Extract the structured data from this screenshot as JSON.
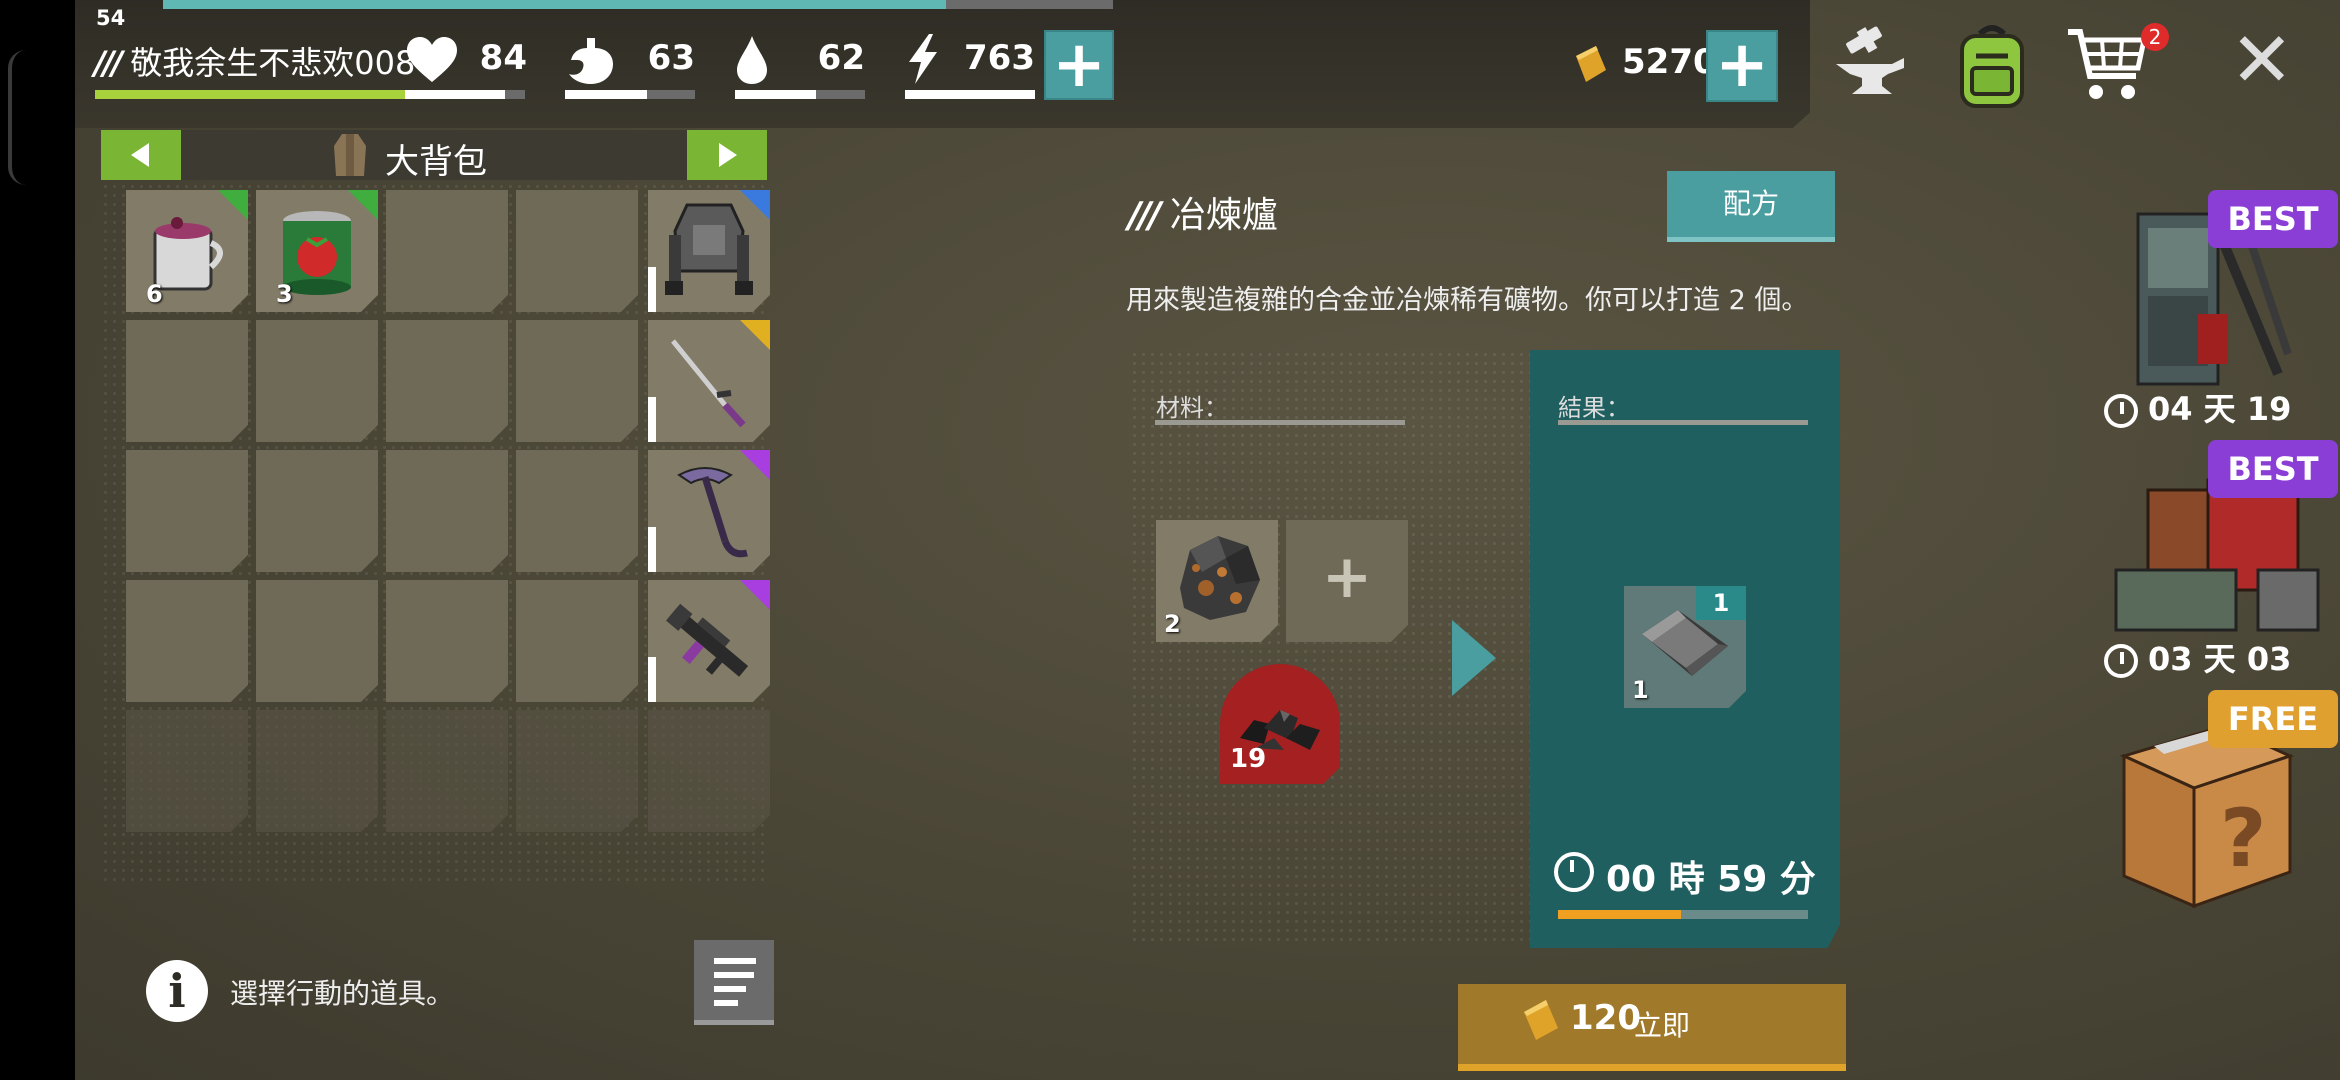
{
  "player": {
    "level": "54",
    "name": "敬我余生不悲欢008",
    "slashes": "///"
  },
  "stats": {
    "health": "84",
    "food": "63",
    "water": "62",
    "energy": "763"
  },
  "currency": {
    "gold": "5270"
  },
  "header_buttons": {
    "cart_badge": "2",
    "close": "✕",
    "plus": "+"
  },
  "inventory": {
    "title": "大背包",
    "slots": [
      {
        "row": 0,
        "col": 0,
        "item": "berry-tea-mug",
        "count": "6",
        "rarity": "#3fae3f"
      },
      {
        "row": 0,
        "col": 1,
        "item": "tomato-can",
        "count": "3",
        "rarity": "#3fae3f"
      },
      {
        "row": 0,
        "col": 4,
        "item": "armor-vest",
        "count": "",
        "rarity": "#3a7adf"
      },
      {
        "row": 1,
        "col": 4,
        "item": "katana",
        "count": "",
        "rarity": "#e0b020"
      },
      {
        "row": 2,
        "col": 4,
        "item": "war-pick",
        "count": "",
        "rarity": "#a93ee0"
      },
      {
        "row": 3,
        "col": 4,
        "item": "assault-rifle",
        "count": "",
        "rarity": "#a93ee0"
      }
    ],
    "hint": "選擇行動的道具。"
  },
  "crafting": {
    "station_slashes": "///",
    "station_title": "冶煉爐",
    "recipe_button": "配方",
    "description": "用來製造複雜的合金並冶煉稀有礦物。你可以打造 2 個。",
    "materials_label": "材料：",
    "result_label": "結果：",
    "material_count": "2",
    "add_symbol": "+",
    "fuel_count": "19",
    "result_count": "1",
    "result_badge": "1",
    "timer": "00 時 59 分",
    "timer_progress": 0.49,
    "instant_amount": "120",
    "instant_label": "立即"
  },
  "offers": [
    {
      "badge": "BEST",
      "timer": "04 天 19",
      "color": "#8a3ed6"
    },
    {
      "badge": "BEST",
      "timer": "03 天 03",
      "color": "#8a3ed6"
    },
    {
      "badge": "FREE",
      "timer": "",
      "color": "#e0a030"
    }
  ]
}
